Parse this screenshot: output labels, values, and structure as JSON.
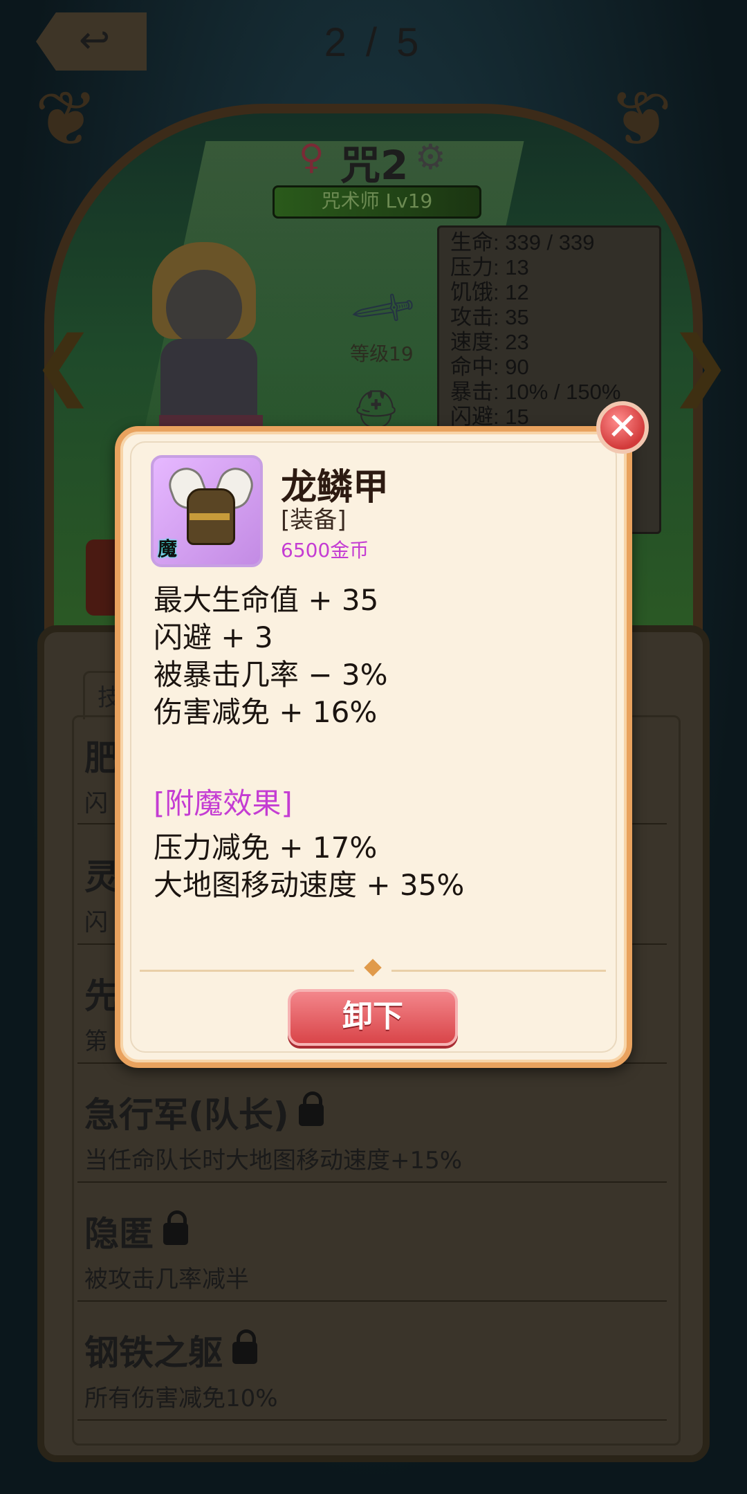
{
  "header": {
    "page_indicator": "2 / 5",
    "back_icon": "back-arrow-icon"
  },
  "character": {
    "gender_symbol": "♀",
    "name": "咒2",
    "class_level": "咒术师 Lv19",
    "weapon_level": "等级19",
    "stats": [
      "生命: 339 / 339",
      "压力: 13",
      "饥饿: 12",
      "攻击: 35",
      "速度: 23",
      "命中: 90",
      "暴击: 10% / 150%",
      "闪避: 15"
    ]
  },
  "skills": {
    "tab_stub": "技",
    "list": [
      {
        "name": "肥",
        "desc": "闪"
      },
      {
        "name": "灵",
        "desc": "闪"
      },
      {
        "name": "先",
        "desc": "第"
      },
      {
        "name": "急行军(队长)",
        "desc": "当任命队长时大地图移动速度+15%",
        "locked": true
      },
      {
        "name": "隐匿",
        "desc": "被攻击几率减半",
        "locked": true
      },
      {
        "name": "钢铁之躯",
        "desc": "所有伤害减免10%",
        "locked": true
      }
    ]
  },
  "item_popup": {
    "name": "龙鳞甲",
    "category": "[装备]",
    "price": "6500金币",
    "icon_tag": "魔",
    "stats": [
      "最大生命值 + 35",
      "闪避 + 3",
      "被暴击几率 − 3%",
      "伤害减免 + 16%"
    ],
    "enchant_title": "[附魔效果]",
    "enchant_stats": [
      "压力减免 + 17%",
      "大地图移动速度 + 35%"
    ],
    "unequip_label": "卸下",
    "close_symbol": "✕"
  },
  "colors": {
    "price": "#c43cd3",
    "enchant": "#c43cd3",
    "modal_border": "#e9a25e",
    "button": "#d94549"
  }
}
